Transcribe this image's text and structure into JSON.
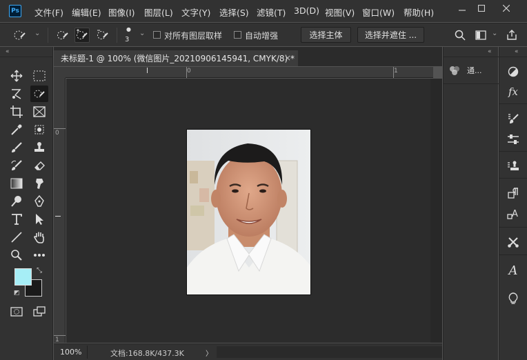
{
  "app": {
    "logo_text": "Ps"
  },
  "menu": [
    "文件(F)",
    "编辑(E)",
    "图像(I)",
    "图层(L)",
    "文字(Y)",
    "选择(S)",
    "滤镜(T)",
    "3D(D)",
    "视图(V)",
    "窗口(W)",
    "帮助(H)"
  ],
  "options": {
    "brush_size": "3",
    "sample_all_layers_label": "对所有图层取样",
    "auto_enhance_label": "自动增强",
    "select_subject_label": "选择主体",
    "select_and_mask_label": "选择并遮住 ..."
  },
  "document": {
    "tab_title": "未标题-1 @ 100% (微信图片_20210906145941, CMYK/8) *",
    "close_glyph": "×",
    "ruler_h_labels": [
      "0",
      "1"
    ],
    "ruler_v_labels": [
      "0",
      "1"
    ]
  },
  "status": {
    "zoom": "100%",
    "doc_info": "文档:168.8K/437.3K",
    "arrow": "〉"
  },
  "panels": {
    "channels_label": "通..."
  },
  "colors": {
    "foreground": "#a6eef6",
    "background": "#1a1a1a",
    "accent": "#3fa9f5"
  },
  "tools": [
    "move-icon",
    "marquee-icon",
    "lasso-icon",
    "quick-select-icon",
    "crop-icon",
    "frame-icon",
    "eyedropper-icon",
    "patch-icon",
    "brush-icon",
    "stamp-icon",
    "history-brush-icon",
    "eraser-icon",
    "gradient-icon",
    "smudge-icon",
    "dodge-icon",
    "pen-icon",
    "type-icon",
    "path-select-icon",
    "line-icon",
    "hand-icon",
    "zoom-icon",
    "more-icon"
  ]
}
